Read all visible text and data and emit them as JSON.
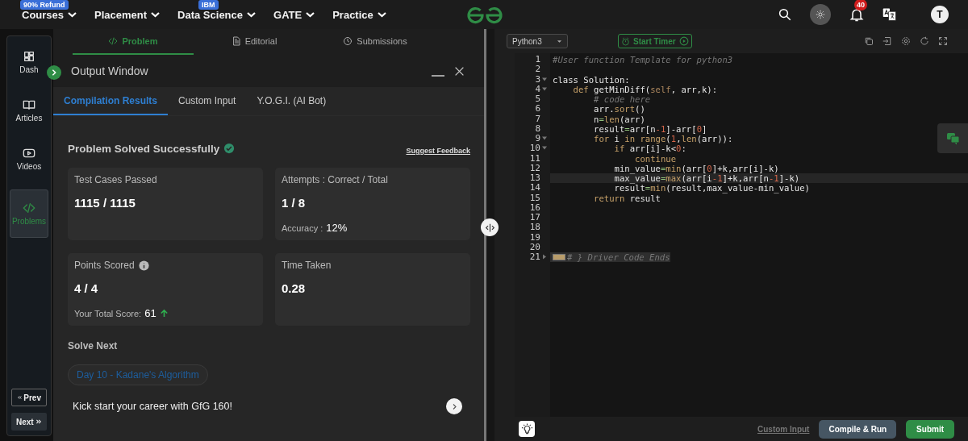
{
  "top_nav": {
    "menus": [
      {
        "label": "Courses",
        "badge": "90% Refund"
      },
      {
        "label": "Placement"
      },
      {
        "label": "Data Science",
        "badge": "IBM"
      },
      {
        "label": "GATE"
      },
      {
        "label": "Practice"
      }
    ],
    "notification_count": "40",
    "avatar": "T"
  },
  "problem_tabs": [
    {
      "label": "Problem",
      "kind": "code",
      "selected": true
    },
    {
      "label": "Editorial",
      "kind": "document",
      "selected": false
    },
    {
      "label": "Submissions",
      "kind": "clock",
      "selected": false
    }
  ],
  "sidebar": {
    "items": [
      {
        "label": "Dash",
        "kind": "dashboard",
        "selected": false
      },
      {
        "label": "Articles",
        "kind": "book",
        "selected": false
      },
      {
        "label": "Videos",
        "kind": "video",
        "selected": false
      },
      {
        "label": "Problems",
        "kind": "code",
        "selected": true
      }
    ],
    "prev": "Prev",
    "next": "Next"
  },
  "output_window": {
    "title": "Output Window",
    "tabs": [
      {
        "label": "Compilation Results",
        "selected": true
      },
      {
        "label": "Custom Input",
        "selected": false
      },
      {
        "label": "Y.O.G.I. (AI Bot)",
        "selected": false
      }
    ],
    "status": "Problem Solved Successfully",
    "feedback_link": "Suggest Feedback",
    "cards": [
      {
        "title": "Test Cases Passed",
        "value": "1115 / 1115",
        "info": false
      },
      {
        "title": "Attempts : Correct / Total",
        "value": "1 / 8",
        "note_label": "Accuracy :",
        "note_value": "12%",
        "info": false
      },
      {
        "title": "Points Scored",
        "value": "4 / 4",
        "note_label": "Your Total Score:",
        "note_value": "61",
        "rising": true,
        "info": true
      },
      {
        "title": "Time Taken",
        "value": "0.28",
        "info": false
      }
    ],
    "solve_next": {
      "heading": "Solve Next",
      "chip": "Day 10 - Kadane's Algorithm",
      "promo": "Kick start your career with GfG 160!"
    }
  },
  "editor": {
    "language": "Python3",
    "timer_button": "Start Timer",
    "lines": [
      {
        "number": "1",
        "active": false,
        "tokens": [
          {
            "text": "#User function Template for python3",
            "kind": "comment"
          }
        ]
      },
      {
        "number": "2",
        "active": false
      },
      {
        "number": "3",
        "folded": false,
        "active": false,
        "tokens": [
          {
            "text": "class Solution:",
            "kind": "plain"
          }
        ]
      },
      {
        "number": "4",
        "folded": false,
        "active": false,
        "tokens": [
          {
            "text": "    def",
            "kind": "keyword"
          },
          {
            "text": " getMinDiff(",
            "kind": "plain"
          },
          {
            "text": "self",
            "kind": "self"
          },
          {
            "text": ", arr,k):",
            "kind": "plain"
          }
        ]
      },
      {
        "number": "5",
        "active": false,
        "tokens": [
          {
            "text": "        # code here",
            "kind": "comment"
          }
        ]
      },
      {
        "number": "6",
        "active": false,
        "tokens": [
          {
            "text": "        arr.",
            "kind": "plain"
          },
          {
            "text": "sort",
            "kind": "keyword"
          },
          {
            "text": "()",
            "kind": "plain"
          }
        ]
      },
      {
        "number": "7",
        "active": false,
        "tokens": [
          {
            "text": "        n",
            "kind": "plain"
          },
          {
            "text": "=",
            "kind": "operator"
          },
          {
            "text": "len",
            "kind": "keyword"
          },
          {
            "text": "(arr)",
            "kind": "plain"
          }
        ]
      },
      {
        "number": "8",
        "active": false,
        "tokens": [
          {
            "text": "        result",
            "kind": "plain"
          },
          {
            "text": "=",
            "kind": "operator"
          },
          {
            "text": "arr[n",
            "kind": "plain"
          },
          {
            "text": "-1",
            "kind": "number"
          },
          {
            "text": "]-arr[",
            "kind": "plain"
          },
          {
            "text": "0",
            "kind": "number"
          },
          {
            "text": "]",
            "kind": "plain"
          }
        ]
      },
      {
        "number": "9",
        "folded": false,
        "active": false,
        "tokens": [
          {
            "text": "        for",
            "kind": "keyword"
          },
          {
            "text": " i ",
            "kind": "plain"
          },
          {
            "text": "in range",
            "kind": "keyword"
          },
          {
            "text": "(",
            "kind": "plain"
          },
          {
            "text": "1",
            "kind": "number"
          },
          {
            "text": ",",
            "kind": "plain"
          },
          {
            "text": "len",
            "kind": "keyword"
          },
          {
            "text": "(arr)):",
            "kind": "plain"
          }
        ]
      },
      {
        "number": "10",
        "folded": false,
        "active": false,
        "tokens": [
          {
            "text": "            if",
            "kind": "keyword"
          },
          {
            "text": " arr[i]-k<",
            "kind": "plain"
          },
          {
            "text": "0",
            "kind": "number"
          },
          {
            "text": ":",
            "kind": "plain"
          }
        ]
      },
      {
        "number": "11",
        "active": false,
        "tokens": [
          {
            "text": "                continue",
            "kind": "keyword"
          }
        ]
      },
      {
        "number": "12",
        "active": false,
        "tokens": [
          {
            "text": "            min_value",
            "kind": "plain"
          },
          {
            "text": "=",
            "kind": "operator"
          },
          {
            "text": "min",
            "kind": "keyword"
          },
          {
            "text": "(arr[",
            "kind": "plain"
          },
          {
            "text": "0",
            "kind": "number"
          },
          {
            "text": "]+k,arr[i]-k)",
            "kind": "plain"
          }
        ]
      },
      {
        "number": "13",
        "active": true,
        "tokens": [
          {
            "text": "            max_value",
            "kind": "plain"
          },
          {
            "text": "=",
            "kind": "operator"
          },
          {
            "text": "max",
            "kind": "keyword"
          },
          {
            "text": "(arr[i",
            "kind": "plain"
          },
          {
            "text": "-1",
            "kind": "number"
          },
          {
            "text": "]+k,arr[n",
            "kind": "plain"
          },
          {
            "text": "-1",
            "kind": "number"
          },
          {
            "text": "]-k)",
            "kind": "plain"
          }
        ]
      },
      {
        "number": "14",
        "active": false,
        "tokens": [
          {
            "text": "            result",
            "kind": "plain"
          },
          {
            "text": "=",
            "kind": "operator"
          },
          {
            "text": "min",
            "kind": "keyword"
          },
          {
            "text": "(result,max_value-min_value)",
            "kind": "plain"
          }
        ]
      },
      {
        "number": "15",
        "active": false,
        "tokens": [
          {
            "text": "        return",
            "kind": "keyword"
          },
          {
            "text": " result",
            "kind": "plain"
          }
        ]
      },
      {
        "number": "16",
        "active": false
      },
      {
        "number": "17",
        "active": false
      },
      {
        "number": "18",
        "active": false
      },
      {
        "number": "19",
        "active": false
      },
      {
        "number": "20",
        "active": false
      },
      {
        "number": "21",
        "folded": true,
        "active": false,
        "tokens": [
          {
            "text": "# } Driver Code Ends",
            "kind": "comment"
          }
        ]
      }
    ],
    "custom_input": "Custom Input",
    "compile_button": "Compile & Run",
    "submit_button": "Submit"
  }
}
